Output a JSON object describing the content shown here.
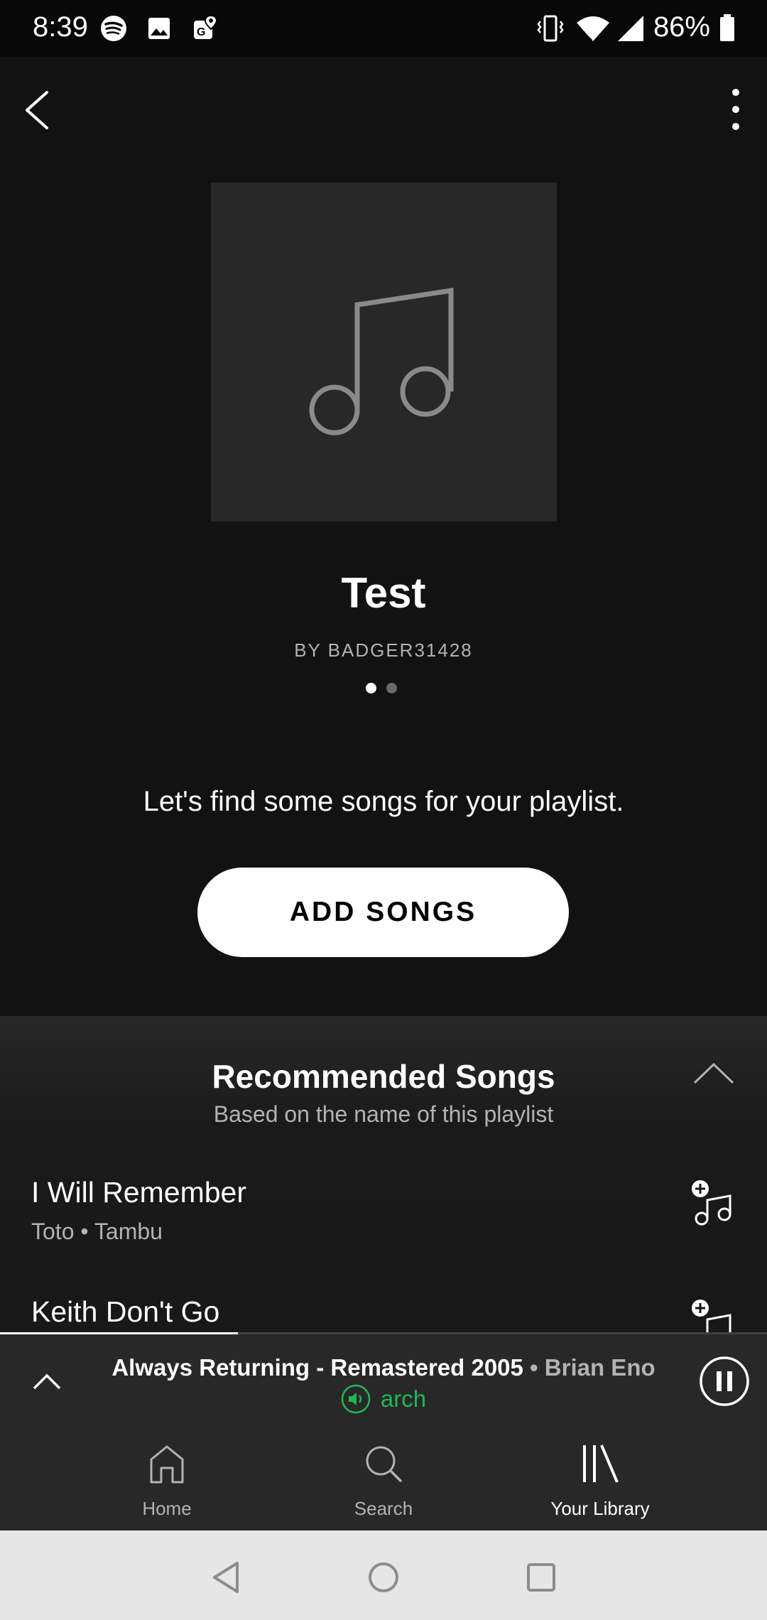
{
  "status_bar": {
    "time": "8:39",
    "battery": "86%",
    "left_icons": [
      "spotify-icon",
      "image-icon",
      "maps-icon"
    ],
    "right_icons": [
      "vibrate-icon",
      "wifi-icon",
      "signal-icon",
      "battery-icon"
    ]
  },
  "header": {
    "back_icon": "chevron-left-icon",
    "more_icon": "more-vertical-icon"
  },
  "playlist": {
    "title": "Test",
    "owner": "BY BADGER31428",
    "page_count": 2,
    "current_page": 1
  },
  "empty_state": {
    "prompt": "Let's find some songs for your playlist.",
    "add_button": "ADD SONGS"
  },
  "recommended": {
    "title": "Recommended Songs",
    "subtitle": "Based on the name of this playlist",
    "songs": [
      {
        "title": "I Will Remember",
        "meta": "Toto • Tambu"
      },
      {
        "title": "Keith Don't Go",
        "meta": ""
      }
    ]
  },
  "now_playing": {
    "track": "Always Returning - Remastered 2005",
    "separator": " • ",
    "artist": "Brian Eno",
    "device": "arch",
    "progress": 0.31,
    "accent_color": "#1db954"
  },
  "bottom_nav": {
    "items": [
      {
        "label": "Home",
        "icon": "home-icon",
        "active": false
      },
      {
        "label": "Search",
        "icon": "search-icon",
        "active": false
      },
      {
        "label": "Your Library",
        "icon": "library-icon",
        "active": true
      }
    ]
  },
  "system_nav": [
    "back-triangle-icon",
    "home-circle-icon",
    "recents-square-icon"
  ]
}
